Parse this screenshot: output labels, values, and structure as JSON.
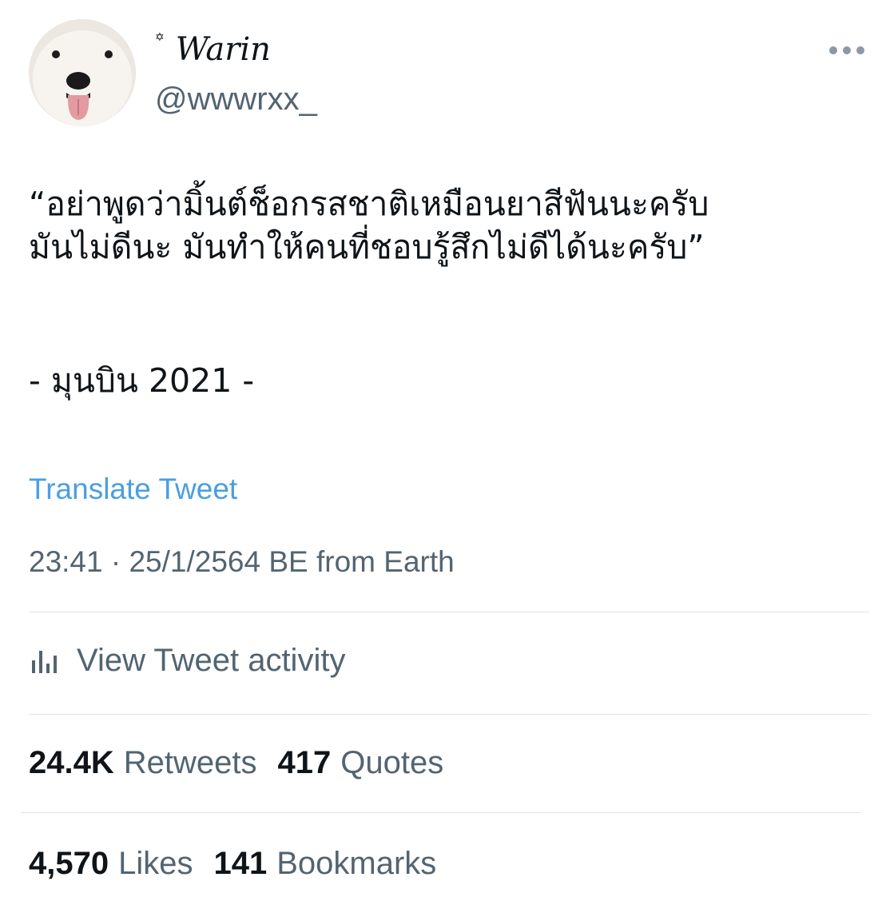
{
  "author": {
    "display_name": "Warin",
    "name_decoration": "✡",
    "handle": "@wwwrxx_"
  },
  "icons": {
    "avatar": "white-dog-avatar",
    "more": "more-options-icon",
    "activity": "bar-chart-icon"
  },
  "tweet": {
    "lines": [
      "“อย่าพูดว่ามิ้นต์ช็อกรสชาติเหมือนยาสีฟันนะครับ",
      "มันไม่ดีนะ มันทำให้คนที่ชอบรู้สึกไม่ดีได้นะครับ”"
    ],
    "signature": "- มุนบิน 2021 -"
  },
  "translate_label": "Translate Tweet",
  "meta_text": "23:41 · 25/1/2564 BE from Earth",
  "activity_label": "View Tweet activity",
  "stats": {
    "retweets": {
      "count": "24.4K",
      "label": "Retweets"
    },
    "quotes": {
      "count": "417",
      "label": "Quotes"
    },
    "likes": {
      "count": "4,570",
      "label": "Likes"
    },
    "bookmarks": {
      "count": "141",
      "label": "Bookmarks"
    }
  },
  "colors": {
    "link": "#4a9fe0",
    "secondary_text": "#536471",
    "primary_text": "#0f1419",
    "divider": "#dfe3e6"
  }
}
